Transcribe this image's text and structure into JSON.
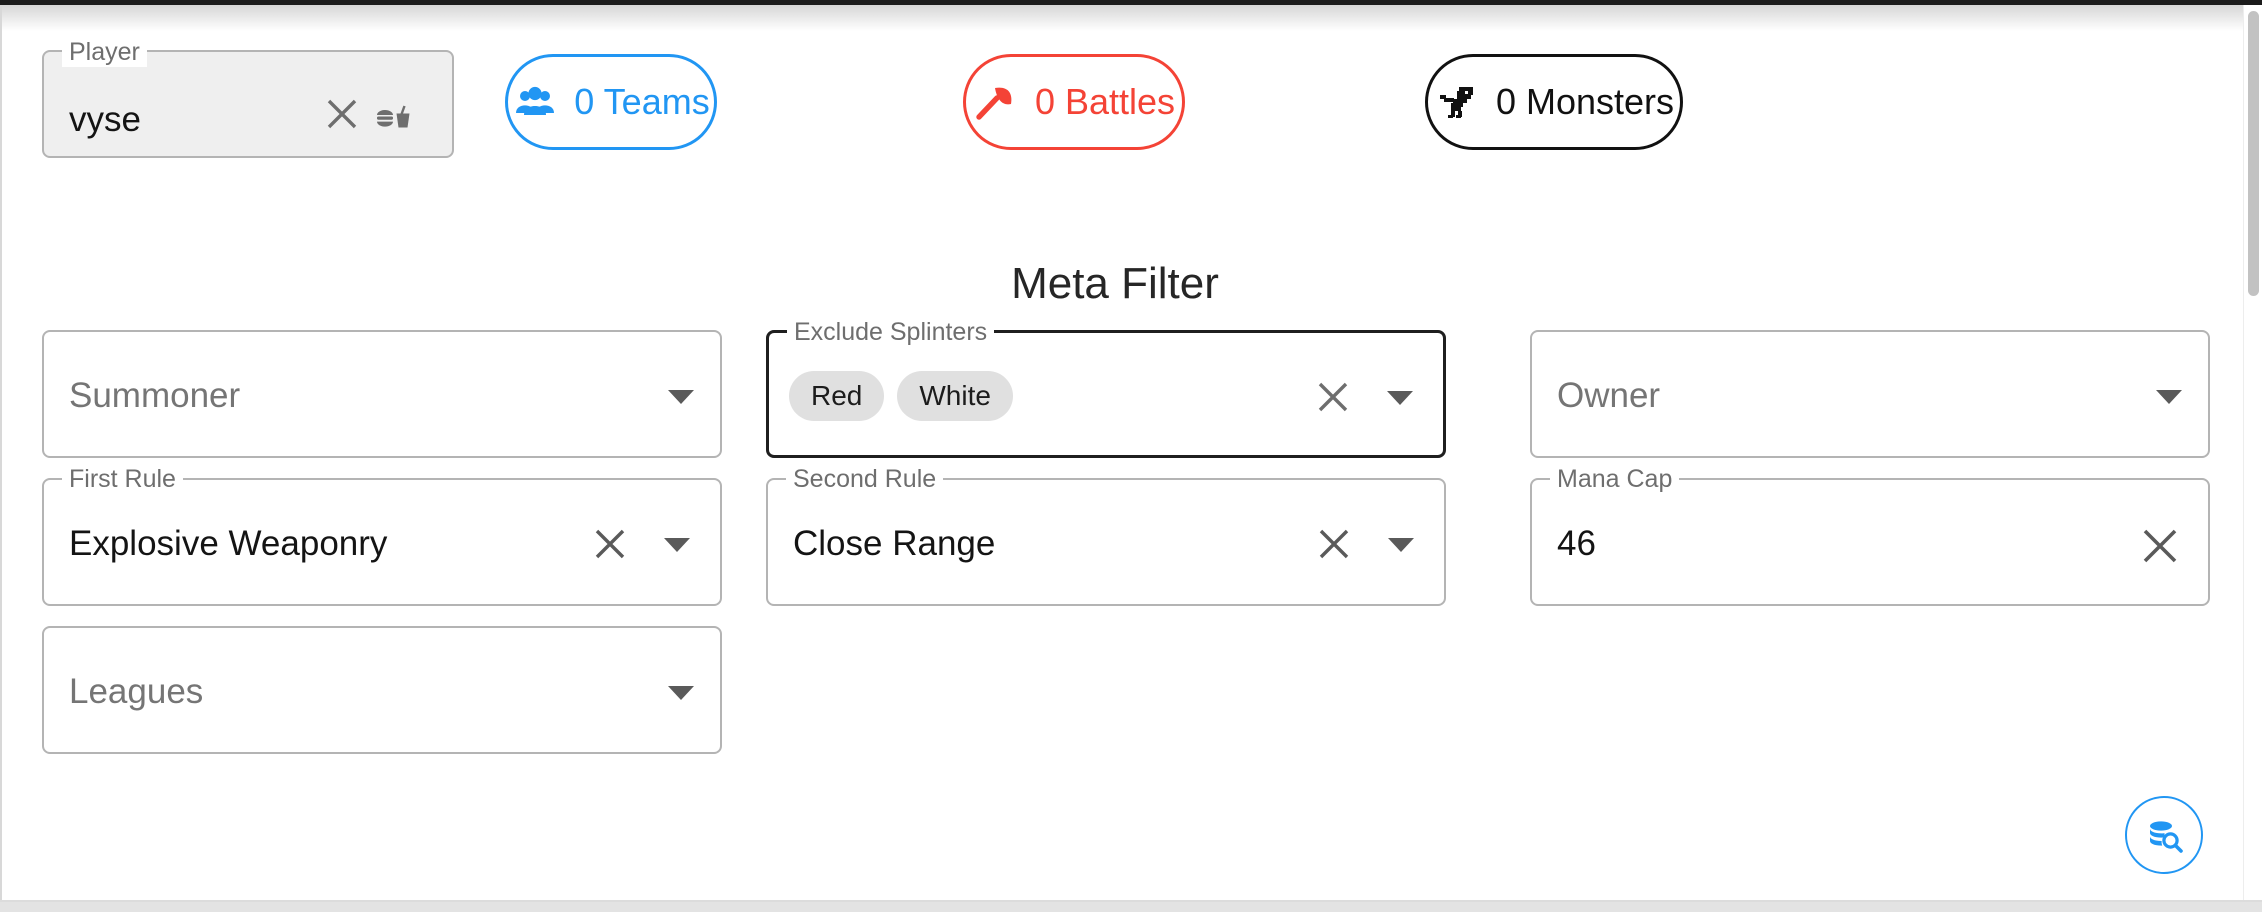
{
  "colors": {
    "teams_accent": "#2196f3",
    "battles_accent": "#f44336",
    "monsters_accent": "#111111",
    "fab_accent": "#2196f3",
    "border": "#b4b4b4",
    "focused_border": "#1f1f1f",
    "tag_background": "#e0e0e0",
    "label_text": "#6e6e6e",
    "placeholder_text": "#757575",
    "value_text": "#141414"
  },
  "summary": {
    "player_field": {
      "legend": "Player",
      "value": "vyse",
      "clear_icon": "close-icon",
      "storage_icon": "local-storage-icon"
    },
    "chips": [
      {
        "name": "teams",
        "count": "0",
        "label": "0 Teams",
        "icon": "groups-icon"
      },
      {
        "name": "battles",
        "count": "0",
        "label": "0 Battles",
        "icon": "gavel-icon"
      },
      {
        "name": "monsters",
        "count": "0",
        "label": "0 Monsters",
        "icon": "dinosaur-icon"
      }
    ]
  },
  "meta_filter": {
    "title": "Meta Filter",
    "rows": [
      {
        "cells": [
          {
            "name": "summoner",
            "kind": "select",
            "legend": "",
            "placeholder": "Summoner",
            "value": "",
            "focused": false,
            "has_clear": false,
            "has_arrow": true,
            "tags": []
          },
          {
            "name": "exclude-splinters",
            "kind": "multiselect",
            "legend": "Exclude Splinters",
            "placeholder": "",
            "value": "",
            "focused": true,
            "has_clear": true,
            "has_arrow": true,
            "tags": [
              "Red",
              "White"
            ]
          },
          {
            "name": "owner",
            "kind": "select",
            "legend": "",
            "placeholder": "Owner",
            "value": "",
            "focused": false,
            "has_clear": false,
            "has_arrow": true,
            "tags": []
          }
        ]
      },
      {
        "cells": [
          {
            "name": "first-rule",
            "kind": "select",
            "legend": "First Rule",
            "placeholder": "",
            "value": "Explosive Weaponry",
            "focused": false,
            "has_clear": true,
            "has_arrow": true,
            "tags": []
          },
          {
            "name": "second-rule",
            "kind": "select",
            "legend": "Second Rule",
            "placeholder": "",
            "value": "Close Range",
            "focused": false,
            "has_clear": true,
            "has_arrow": true,
            "tags": []
          },
          {
            "name": "mana-cap",
            "kind": "text",
            "legend": "Mana Cap",
            "placeholder": "",
            "value": "46",
            "focused": false,
            "has_clear": true,
            "has_arrow": false,
            "tags": []
          }
        ]
      },
      {
        "cells": [
          {
            "name": "leagues",
            "kind": "select",
            "legend": "",
            "placeholder": "Leagues",
            "value": "",
            "focused": false,
            "has_clear": false,
            "has_arrow": true,
            "tags": []
          }
        ]
      }
    ]
  },
  "fab": {
    "name": "run-query-button",
    "icon": "database-search-icon"
  }
}
